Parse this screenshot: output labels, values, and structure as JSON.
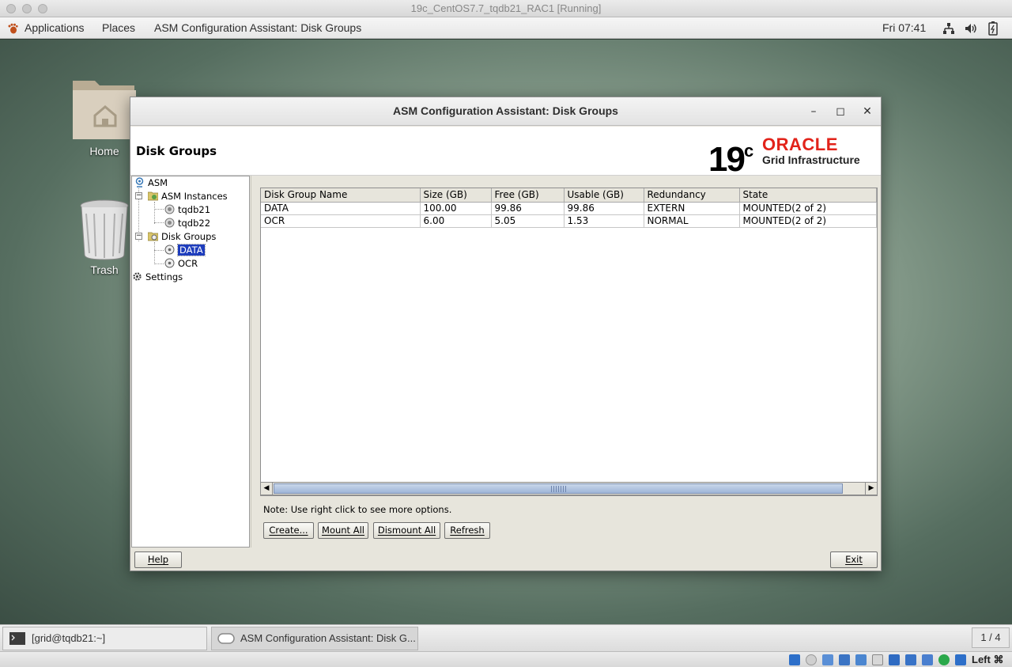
{
  "host": {
    "title": "19c_CentOS7.7_tqdb21_RAC1 [Running]",
    "host_key_label": "Left ⌘",
    "status_icons": [
      "optical-drive-icon",
      "audio-icon",
      "usb-icon",
      "network-icon",
      "pencil-icon",
      "shared-folder-icon",
      "display-icon",
      "recording-icon",
      "virtualization-icon",
      "mouse-integration-icon",
      "arrow-down-icon"
    ]
  },
  "gnome_panel": {
    "applications_label": "Applications",
    "places_label": "Places",
    "active_app_label": "ASM Configuration Assistant: Disk Groups",
    "clock": "Fri 07:41"
  },
  "desktop": {
    "icons": [
      {
        "label": "Home"
      },
      {
        "label": "Trash"
      }
    ]
  },
  "window": {
    "title": "ASM Configuration Assistant: Disk Groups",
    "header_title": "Disk Groups",
    "logo": {
      "version": "19",
      "version_sup": "c",
      "brand": "ORACLE",
      "product": "Grid Infrastructure"
    },
    "tree": [
      {
        "label": "ASM"
      },
      {
        "label": "ASM Instances"
      },
      {
        "label": "tqdb21"
      },
      {
        "label": "tqdb22"
      },
      {
        "label": "Disk Groups"
      },
      {
        "label": "DATA",
        "selected": true
      },
      {
        "label": "OCR"
      },
      {
        "label": "Settings"
      }
    ],
    "table": {
      "columns": [
        "Disk Group Name",
        "Size (GB)",
        "Free (GB)",
        "Usable (GB)",
        "Redundancy",
        "State"
      ],
      "rows": [
        [
          "DATA",
          "100.00",
          "99.86",
          "99.86",
          "EXTERN",
          "MOUNTED(2 of 2)"
        ],
        [
          "OCR",
          "6.00",
          "5.05",
          "1.53",
          "NORMAL",
          "MOUNTED(2 of 2)"
        ]
      ]
    },
    "note": "Note: Use right click to see more options.",
    "buttons": {
      "create": "Create...",
      "mount_all": "Mount All",
      "dismount_all": "Dismount All",
      "refresh": "Refresh",
      "help": "Help",
      "exit": "Exit"
    }
  },
  "taskbar": {
    "tasks": [
      {
        "label": "[grid@tqdb21:~]"
      },
      {
        "label": "ASM Configuration Assistant: Disk G..."
      }
    ],
    "pager": "1 / 4"
  }
}
